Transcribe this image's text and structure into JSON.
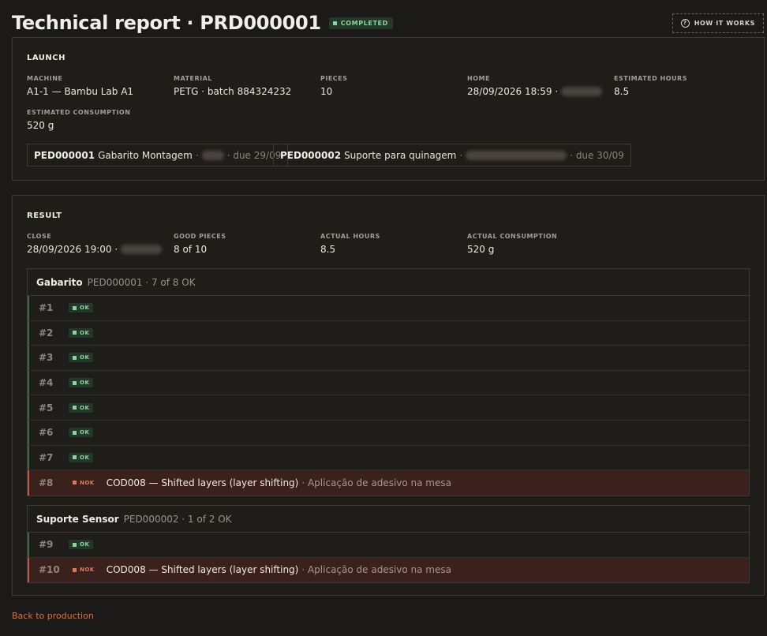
{
  "header": {
    "title": "Technical report · PRD000001",
    "status": "COMPLETED",
    "how_it_works": "HOW IT WORKS",
    "status_color": "#8ed39a"
  },
  "launch": {
    "section_title": "LAUNCH",
    "fields": {
      "machine": {
        "label": "MACHINE",
        "value": "A1-1 — Bambu Lab A1"
      },
      "material": {
        "label": "MATERIAL",
        "value": "PETG · batch 884324232"
      },
      "pieces": {
        "label": "PIECES",
        "value": "10"
      },
      "home": {
        "label": "HOME",
        "value": "28/09/2026 18:59 ·"
      },
      "estimated_hours": {
        "label": "ESTIMATED HOURS",
        "value": "8.5"
      },
      "estimated_consumption": {
        "label": "ESTIMATED CONSUMPTION",
        "value": "520 g"
      }
    },
    "orders": [
      {
        "id": "PED000001",
        "name": "Gabarito Montagem",
        "sep": "·",
        "due": "· due 29/09"
      },
      {
        "id": "PED000002",
        "name": "Suporte para quinagem",
        "sep": "·",
        "due": "· due 30/09"
      }
    ]
  },
  "result": {
    "section_title": "RESULT",
    "fields": {
      "close": {
        "label": "CLOSE",
        "value": "28/09/2026 19:00 ·"
      },
      "good_pieces": {
        "label": "GOOD PIECES",
        "value": "8 of 10"
      },
      "actual_hours": {
        "label": "ACTUAL HOURS",
        "value": "8.5"
      },
      "actual_consumption": {
        "label": "ACTUAL CONSUMPTION",
        "value": "520 g"
      }
    },
    "groups": [
      {
        "name": "Gabarito",
        "meta": "PED000001 · 7 of 8 OK",
        "pieces": [
          {
            "num": "#1",
            "status": "OK"
          },
          {
            "num": "#2",
            "status": "OK"
          },
          {
            "num": "#3",
            "status": "OK"
          },
          {
            "num": "#4",
            "status": "OK"
          },
          {
            "num": "#5",
            "status": "OK"
          },
          {
            "num": "#6",
            "status": "OK"
          },
          {
            "num": "#7",
            "status": "OK"
          },
          {
            "num": "#8",
            "status": "NOK",
            "defect": "COD008 — Shifted layers (layer shifting)",
            "action": "· Aplicação de adesivo na mesa"
          }
        ]
      },
      {
        "name": "Suporte Sensor",
        "meta": "PED000002 · 1 of 2 OK",
        "pieces": [
          {
            "num": "#9",
            "status": "OK"
          },
          {
            "num": "#10",
            "status": "NOK",
            "defect": "COD008 — Shifted layers (layer shifting)",
            "action": "· Aplicação de adesivo na mesa"
          }
        ]
      }
    ]
  },
  "footer": {
    "back_link": "Back to production"
  }
}
